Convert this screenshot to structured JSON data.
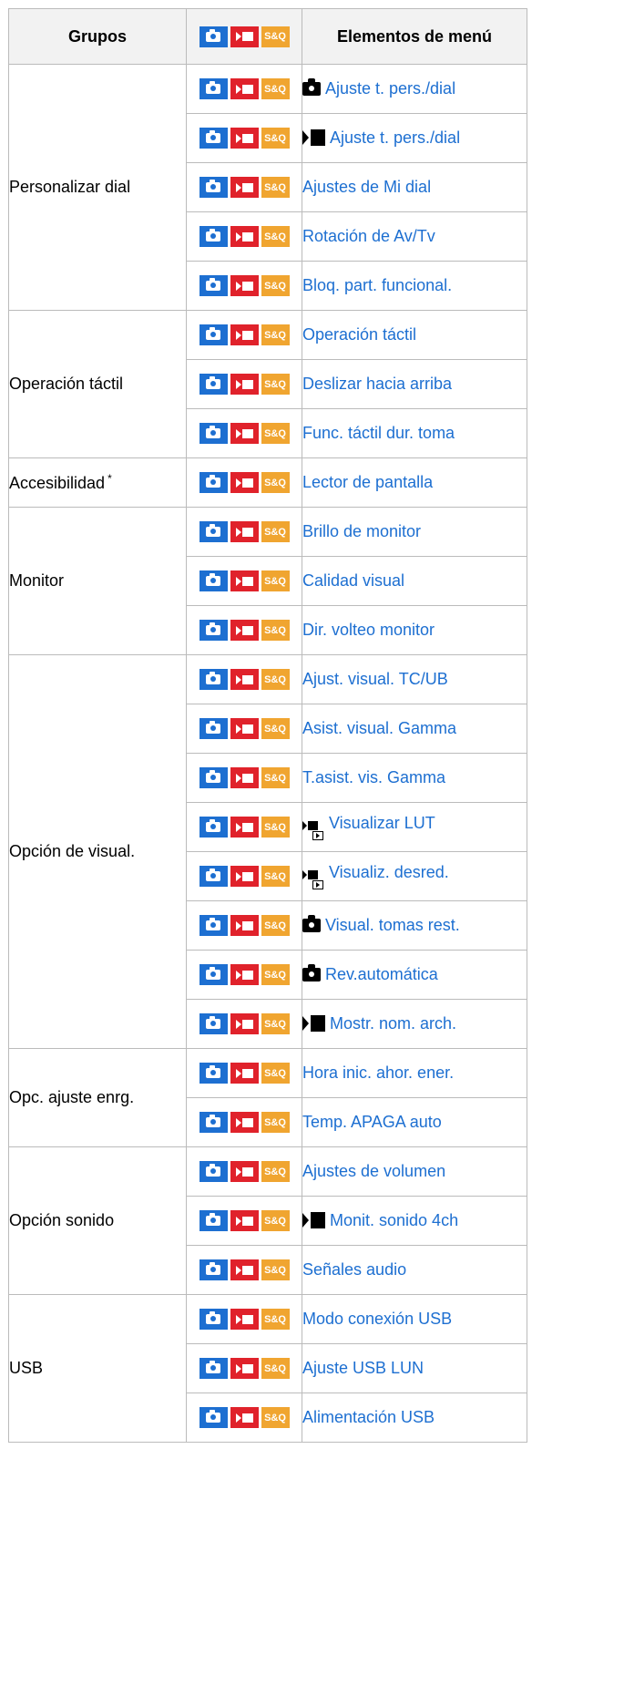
{
  "header": {
    "groups": "Grupos",
    "items": "Elementos de menú"
  },
  "badge_label": "S&Q",
  "colors": {
    "photo": "#1d6fd1",
    "movie": "#e0222b",
    "sq": "#f0a530",
    "link": "#1d6fd1"
  },
  "groups": [
    {
      "name": "Personalizar dial",
      "rows": [
        {
          "prefix": "photo",
          "label": "Ajuste t. pers./dial"
        },
        {
          "prefix": "movie",
          "label": "Ajuste t. pers./dial"
        },
        {
          "prefix": "",
          "label": "Ajustes de Mi dial"
        },
        {
          "prefix": "",
          "label": "Rotación de Av/Tv"
        },
        {
          "prefix": "",
          "label": "Bloq. part. funcional."
        }
      ]
    },
    {
      "name": "Operación táctil",
      "rows": [
        {
          "prefix": "",
          "label": "Operación táctil"
        },
        {
          "prefix": "",
          "label": "Deslizar hacia arriba"
        },
        {
          "prefix": "",
          "label": "Func. táctil dur. toma"
        }
      ]
    },
    {
      "name": "Accesibilidad",
      "sup": "*",
      "rows": [
        {
          "prefix": "",
          "label": "Lector de pantalla"
        }
      ]
    },
    {
      "name": "Monitor",
      "rows": [
        {
          "prefix": "",
          "label": "Brillo de monitor"
        },
        {
          "prefix": "",
          "label": "Calidad visual"
        },
        {
          "prefix": "",
          "label": "Dir. volteo monitor"
        }
      ]
    },
    {
      "name": "Opción de visual.",
      "rows": [
        {
          "prefix": "",
          "label": "Ajust. visual. TC/UB"
        },
        {
          "prefix": "",
          "label": "Asist. visual. Gamma"
        },
        {
          "prefix": "",
          "label": "T.asist. vis. Gamma"
        },
        {
          "prefix": "movie-play",
          "label": "Visualizar LUT"
        },
        {
          "prefix": "movie-play",
          "label": "Visualiz. desred."
        },
        {
          "prefix": "photo",
          "label": "Visual. tomas rest."
        },
        {
          "prefix": "photo",
          "label": "Rev.automática"
        },
        {
          "prefix": "movie",
          "label": "Mostr. nom. arch."
        }
      ]
    },
    {
      "name": "Opc. ajuste enrg.",
      "rows": [
        {
          "prefix": "",
          "label": "Hora inic. ahor. ener."
        },
        {
          "prefix": "",
          "label": "Temp. APAGA auto"
        }
      ]
    },
    {
      "name": "Opción sonido",
      "rows": [
        {
          "prefix": "",
          "label": "Ajustes de volumen"
        },
        {
          "prefix": "movie",
          "label": "Monit. sonido 4ch"
        },
        {
          "prefix": "",
          "label": "Señales audio"
        }
      ]
    },
    {
      "name": "USB",
      "rows": [
        {
          "prefix": "",
          "label": "Modo conexión USB"
        },
        {
          "prefix": "",
          "label": "Ajuste USB LUN"
        },
        {
          "prefix": "",
          "label": "Alimentación USB"
        }
      ]
    }
  ]
}
